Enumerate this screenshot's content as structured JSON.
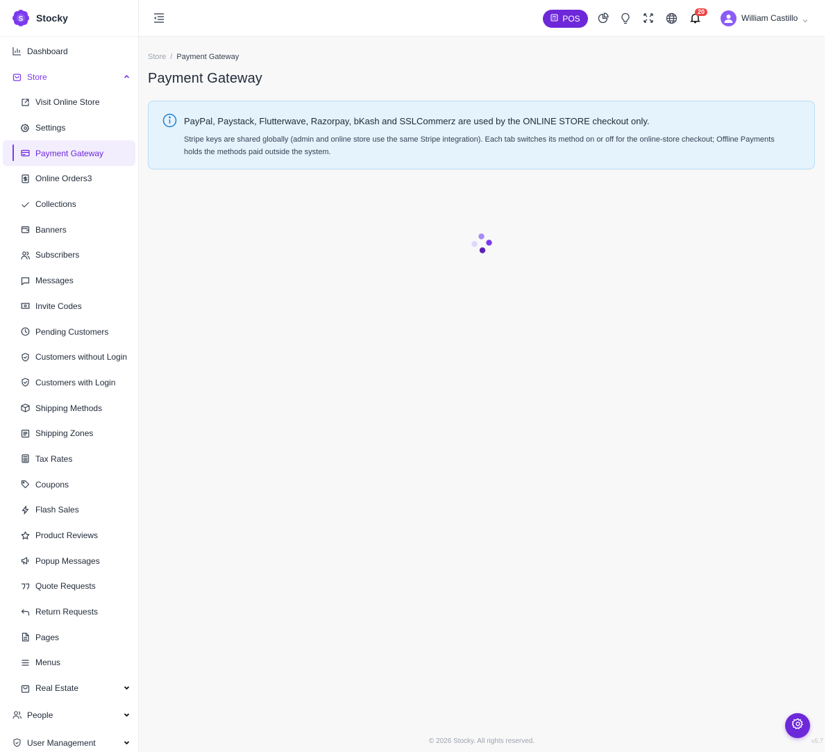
{
  "brand": {
    "name": "Stocky",
    "logo_letter": "S"
  },
  "sidebar": {
    "dashboard": "Dashboard",
    "store": "Store",
    "store_items": [
      {
        "label": "Visit Online Store",
        "icon": "external-link-icon"
      },
      {
        "label": "Settings",
        "icon": "gear-icon"
      },
      {
        "label": "Payment Gateway",
        "icon": "credit-card-icon",
        "active": true
      },
      {
        "label": "Online Orders3",
        "icon": "receipt-icon"
      },
      {
        "label": "Collections",
        "icon": "check-icon"
      },
      {
        "label": "Banners",
        "icon": "wallet-icon"
      },
      {
        "label": "Subscribers",
        "icon": "users-icon"
      },
      {
        "label": "Messages",
        "icon": "message-icon"
      },
      {
        "label": "Invite Codes",
        "icon": "ticket-icon"
      },
      {
        "label": "Pending Customers",
        "icon": "clock-icon"
      },
      {
        "label": "Customers without Login",
        "icon": "shield-check-icon"
      },
      {
        "label": "Customers with Login",
        "icon": "shield-check-icon"
      },
      {
        "label": "Shipping Methods",
        "icon": "box-icon"
      },
      {
        "label": "Shipping Zones",
        "icon": "map-icon"
      },
      {
        "label": "Tax Rates",
        "icon": "calculator-icon"
      },
      {
        "label": "Coupons",
        "icon": "tag-icon"
      },
      {
        "label": "Flash Sales",
        "icon": "bolt-icon"
      },
      {
        "label": "Product Reviews",
        "icon": "star-icon"
      },
      {
        "label": "Popup Messages",
        "icon": "megaphone-icon"
      },
      {
        "label": "Quote Requests",
        "icon": "quote-icon"
      },
      {
        "label": "Return Requests",
        "icon": "return-icon"
      },
      {
        "label": "Pages",
        "icon": "file-icon"
      },
      {
        "label": "Menus",
        "icon": "menu-icon"
      },
      {
        "label": "Real Estate",
        "icon": "building-icon"
      }
    ],
    "people": "People",
    "user_management": "User Management"
  },
  "topbar": {
    "pos_label": "POS",
    "notification_count": "20",
    "user_name": "William Castillo"
  },
  "breadcrumb": {
    "parent": "Store",
    "current": "Payment Gateway"
  },
  "page_title": "Payment Gateway",
  "alert": {
    "title": "PayPal, Paystack, Flutterwave, Razorpay, bKash and SSLCommerz are used by the ONLINE STORE checkout only.",
    "body": "Stripe keys are shared globally (admin and online store use the same Stripe integration). Each tab switches its method on or off for the online-store checkout; Offline Payments holds the methods paid outside the system."
  },
  "footer": {
    "copyright": "© 2026 Stocky. All rights reserved.",
    "version": "v5.7"
  },
  "colors": {
    "accent": "#6d28d9",
    "alert_bg": "#e5f3fd",
    "alert_border": "#b8dcf5",
    "badge": "#ef4444"
  }
}
